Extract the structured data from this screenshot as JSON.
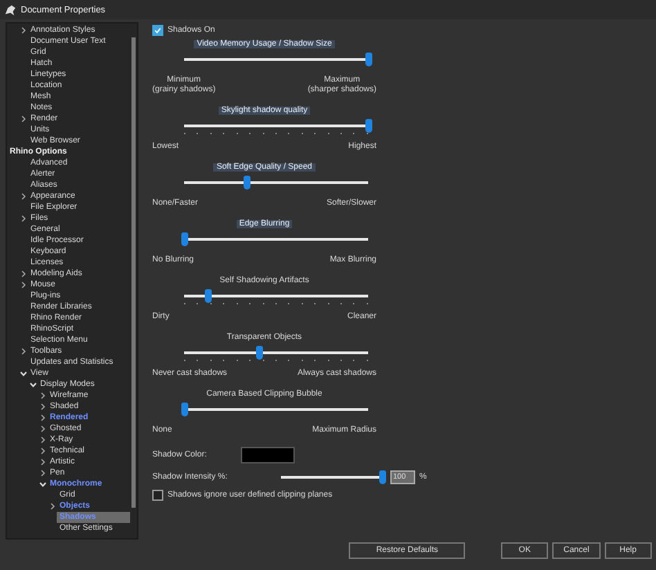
{
  "window": {
    "title": "Document Properties"
  },
  "tree": [
    {
      "label": "Annotation Styles",
      "kind": "item",
      "expandable": true,
      "expanded": false,
      "modified": false,
      "selected": false
    },
    {
      "label": "Document User Text",
      "kind": "item",
      "expandable": false,
      "modified": false,
      "selected": false
    },
    {
      "label": "Grid",
      "kind": "item",
      "expandable": false,
      "modified": false,
      "selected": false
    },
    {
      "label": "Hatch",
      "kind": "item",
      "expandable": false,
      "modified": false,
      "selected": false
    },
    {
      "label": "Linetypes",
      "kind": "item",
      "expandable": false,
      "modified": false,
      "selected": false
    },
    {
      "label": "Location",
      "kind": "item",
      "expandable": false,
      "modified": false,
      "selected": false
    },
    {
      "label": "Mesh",
      "kind": "item",
      "expandable": false,
      "modified": false,
      "selected": false
    },
    {
      "label": "Notes",
      "kind": "item",
      "expandable": false,
      "modified": false,
      "selected": false
    },
    {
      "label": "Render",
      "kind": "item",
      "expandable": true,
      "expanded": false,
      "modified": false,
      "selected": false
    },
    {
      "label": "Units",
      "kind": "item",
      "expandable": false,
      "modified": false,
      "selected": false
    },
    {
      "label": "Web Browser",
      "kind": "item",
      "expandable": false,
      "modified": false,
      "selected": false
    },
    {
      "label": "Rhino Options",
      "kind": "header",
      "children": [
        {
          "label": "Advanced",
          "kind": "item",
          "expandable": false,
          "modified": false,
          "selected": false
        },
        {
          "label": "Alerter",
          "kind": "item",
          "expandable": false,
          "modified": false,
          "selected": false
        },
        {
          "label": "Aliases",
          "kind": "item",
          "expandable": false,
          "modified": false,
          "selected": false
        },
        {
          "label": "Appearance",
          "kind": "item",
          "expandable": true,
          "expanded": false,
          "modified": false,
          "selected": false
        },
        {
          "label": "File Explorer",
          "kind": "item",
          "expandable": false,
          "modified": false,
          "selected": false
        },
        {
          "label": "Files",
          "kind": "item",
          "expandable": true,
          "expanded": false,
          "modified": false,
          "selected": false
        },
        {
          "label": "General",
          "kind": "item",
          "expandable": false,
          "modified": false,
          "selected": false
        },
        {
          "label": "Idle Processor",
          "kind": "item",
          "expandable": false,
          "modified": false,
          "selected": false
        },
        {
          "label": "Keyboard",
          "kind": "item",
          "expandable": false,
          "modified": false,
          "selected": false
        },
        {
          "label": "Licenses",
          "kind": "item",
          "expandable": false,
          "modified": false,
          "selected": false
        },
        {
          "label": "Modeling Aids",
          "kind": "item",
          "expandable": true,
          "expanded": false,
          "modified": false,
          "selected": false
        },
        {
          "label": "Mouse",
          "kind": "item",
          "expandable": true,
          "expanded": false,
          "modified": false,
          "selected": false
        },
        {
          "label": "Plug-ins",
          "kind": "item",
          "expandable": false,
          "modified": false,
          "selected": false
        },
        {
          "label": "Render Libraries",
          "kind": "item",
          "expandable": false,
          "modified": false,
          "selected": false
        },
        {
          "label": "Rhino Render",
          "kind": "item",
          "expandable": false,
          "modified": false,
          "selected": false
        },
        {
          "label": "RhinoScript",
          "kind": "item",
          "expandable": false,
          "modified": false,
          "selected": false
        },
        {
          "label": "Selection Menu",
          "kind": "item",
          "expandable": false,
          "modified": false,
          "selected": false
        },
        {
          "label": "Toolbars",
          "kind": "item",
          "expandable": true,
          "expanded": false,
          "modified": false,
          "selected": false
        },
        {
          "label": "Updates and Statistics",
          "kind": "item",
          "expandable": false,
          "modified": false,
          "selected": false
        },
        {
          "label": "View",
          "kind": "item",
          "expandable": true,
          "expanded": true,
          "modified": false,
          "selected": false,
          "children": [
            {
              "label": "Display Modes",
              "kind": "item",
              "expandable": true,
              "expanded": true,
              "modified": false,
              "selected": false,
              "children": [
                {
                  "label": "Wireframe",
                  "kind": "item",
                  "expandable": true,
                  "expanded": false,
                  "modified": false,
                  "selected": false
                },
                {
                  "label": "Shaded",
                  "kind": "item",
                  "expandable": true,
                  "expanded": false,
                  "modified": false,
                  "selected": false
                },
                {
                  "label": "Rendered",
                  "kind": "item",
                  "expandable": true,
                  "expanded": false,
                  "modified": true,
                  "selected": false
                },
                {
                  "label": "Ghosted",
                  "kind": "item",
                  "expandable": true,
                  "expanded": false,
                  "modified": false,
                  "selected": false
                },
                {
                  "label": "X-Ray",
                  "kind": "item",
                  "expandable": true,
                  "expanded": false,
                  "modified": false,
                  "selected": false
                },
                {
                  "label": "Technical",
                  "kind": "item",
                  "expandable": true,
                  "expanded": false,
                  "modified": false,
                  "selected": false
                },
                {
                  "label": "Artistic",
                  "kind": "item",
                  "expandable": true,
                  "expanded": false,
                  "modified": false,
                  "selected": false
                },
                {
                  "label": "Pen",
                  "kind": "item",
                  "expandable": true,
                  "expanded": false,
                  "modified": false,
                  "selected": false
                },
                {
                  "label": "Monochrome",
                  "kind": "item",
                  "expandable": true,
                  "expanded": true,
                  "modified": true,
                  "selected": false,
                  "children": [
                    {
                      "label": "Grid",
                      "kind": "item",
                      "expandable": false,
                      "modified": false,
                      "selected": false
                    },
                    {
                      "label": "Objects",
                      "kind": "item",
                      "expandable": true,
                      "expanded": false,
                      "modified": true,
                      "selected": false
                    },
                    {
                      "label": "Shadows",
                      "kind": "item",
                      "expandable": false,
                      "modified": true,
                      "selected": true
                    },
                    {
                      "label": "Other Settings",
                      "kind": "item",
                      "expandable": false,
                      "modified": false,
                      "selected": false
                    }
                  ]
                }
              ]
            }
          ]
        }
      ]
    }
  ],
  "shadows_on": {
    "label": "Shadows On",
    "checked": true
  },
  "sliders": [
    {
      "title": "Video Memory Usage / Shadow Size",
      "highlighted": true,
      "ticks": false,
      "level": 1.0,
      "min_label": "Minimum\n(grainy shadows)",
      "max_label": "Maximum\n(sharper shadows)"
    },
    {
      "title": "Skylight shadow quality",
      "highlighted": true,
      "ticks": true,
      "level": 1.0,
      "min_label": "Lowest",
      "max_label": "Highest"
    },
    {
      "title": "Soft Edge Quality / Speed",
      "highlighted": true,
      "ticks": false,
      "level": 0.34,
      "min_label": "None/Faster",
      "max_label": "Softer/Slower"
    },
    {
      "title": "Edge Blurring",
      "highlighted": true,
      "ticks": false,
      "level": 0.0,
      "min_label": "No Blurring",
      "max_label": "Max Blurring"
    },
    {
      "title": "Self Shadowing Artifacts",
      "highlighted": false,
      "ticks": true,
      "level": 0.13,
      "min_label": "Dirty",
      "max_label": "Cleaner"
    },
    {
      "title": "Transparent Objects",
      "highlighted": false,
      "ticks": true,
      "level": 0.41,
      "min_label": "Never cast shadows",
      "max_label": "Always cast shadows"
    },
    {
      "title": "Camera Based Clipping Bubble",
      "highlighted": false,
      "ticks": false,
      "level": 0.0,
      "min_label": "None",
      "max_label": "Maximum Radius"
    }
  ],
  "shadow_color": {
    "label": "Shadow Color:",
    "color": "#000000"
  },
  "shadow_intensity": {
    "label": "Shadow Intensity %:",
    "level": 1.0,
    "value": "100",
    "unit": "%"
  },
  "ignore_clipping": {
    "label": "Shadows ignore user defined clipping planes",
    "checked": false
  },
  "buttons": {
    "restore": "Restore Defaults",
    "ok": "OK",
    "cancel": "Cancel",
    "help": "Help"
  }
}
